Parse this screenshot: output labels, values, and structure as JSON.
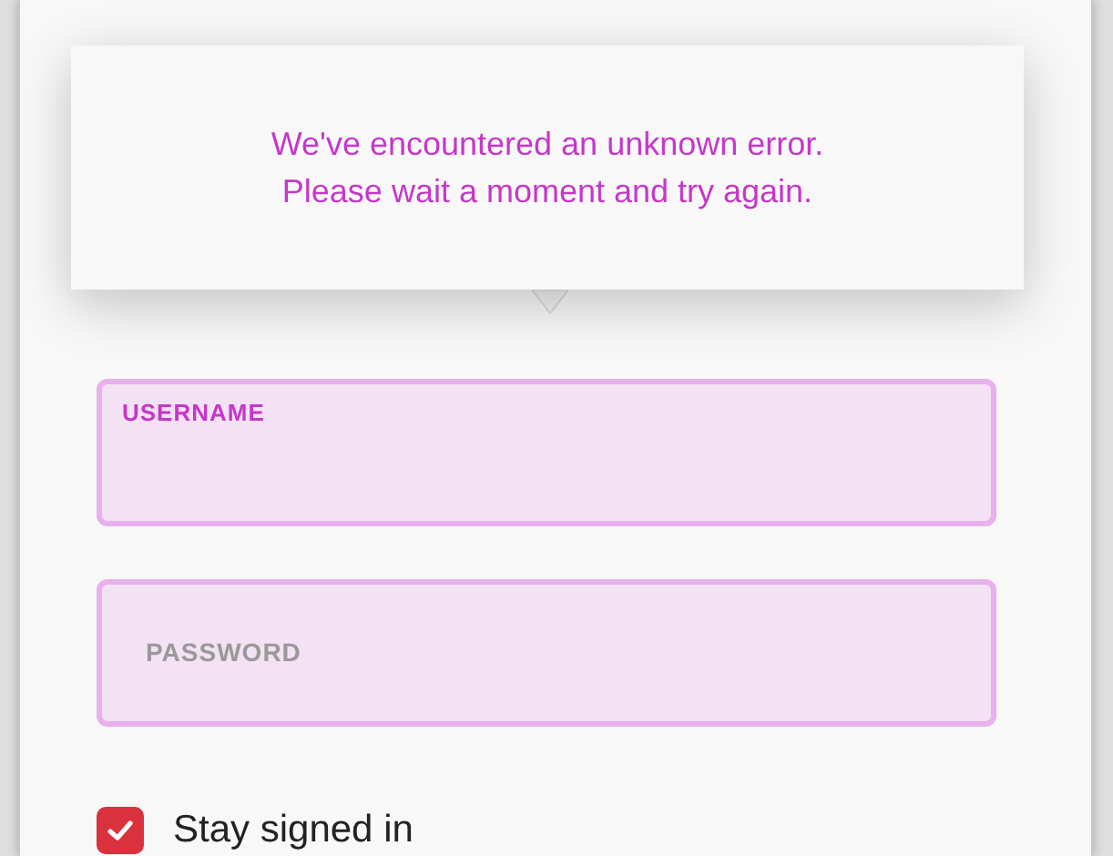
{
  "error_tooltip": {
    "message": "We've encountered an unknown error.\nPlease wait a moment and try again."
  },
  "fields": [
    {
      "label": "USERNAME",
      "focused": true
    },
    {
      "label": "PASSWORD",
      "focused": false
    }
  ],
  "stay_signed_in": {
    "label": "Stay signed in",
    "checked": true
  }
}
